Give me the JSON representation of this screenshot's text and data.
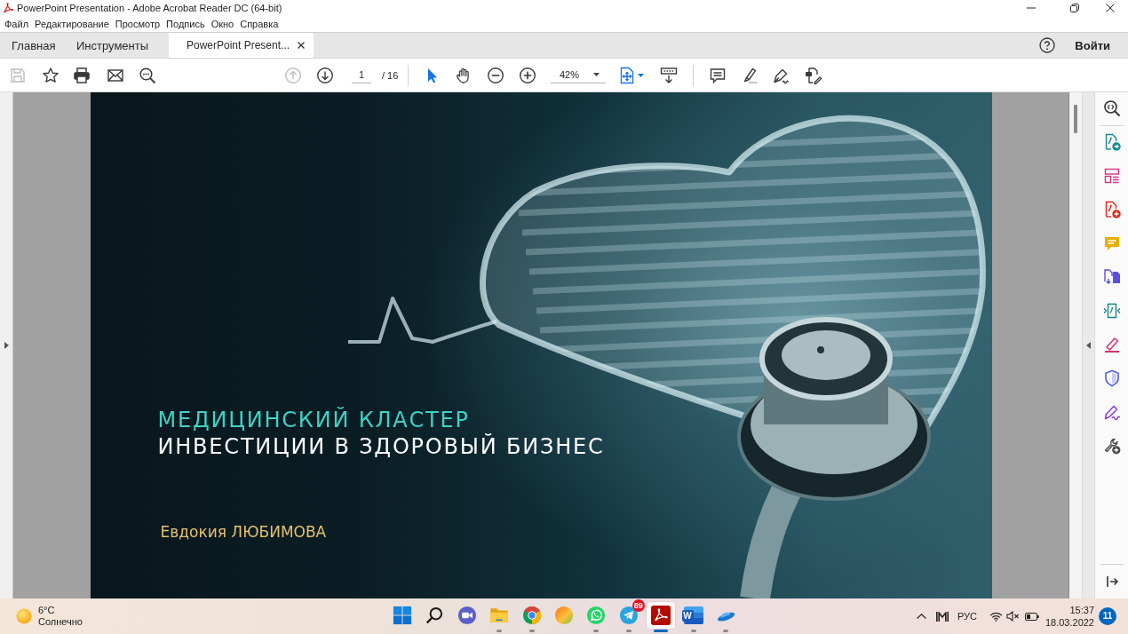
{
  "window": {
    "title": "PowerPoint Presentation - Adobe Acrobat Reader DC (64-bit)"
  },
  "menu": [
    "Файл",
    "Редактирование",
    "Просмотр",
    "Подпись",
    "Окно",
    "Справка"
  ],
  "tabs": [
    {
      "label": "Главная",
      "kind": "nav",
      "selected": false
    },
    {
      "label": "Инструменты",
      "kind": "nav",
      "selected": false
    },
    {
      "label": "PowerPoint Present...",
      "kind": "document",
      "selected": true
    }
  ],
  "sign_in": "Войти",
  "toolbar": {
    "save": {
      "disabled": true
    },
    "previous_page": {
      "disabled": true
    },
    "next_page": {
      "disabled": false
    },
    "page_number": "1",
    "page_count": "/ 16",
    "pointer_tools": [
      {
        "kind": "select",
        "selected": true
      },
      {
        "kind": "hand",
        "selected": false
      }
    ],
    "zoom": "42%"
  },
  "document": {
    "slide": {
      "title": "МЕДИЦИНСКИЙ КЛАСТЕР",
      "subtitle": "ИНВЕСТИЦИИ В ЗДОРОВЫЙ БИЗНЕС",
      "author": "Евдокия ЛЮБИМОВА"
    }
  },
  "taskbar": {
    "weather": {
      "temperature": "6°C",
      "condition": "Солнечно"
    },
    "apps": [
      {
        "kind": "start",
        "running": false,
        "selected": false
      },
      {
        "kind": "search",
        "running": false,
        "selected": false
      },
      {
        "kind": "chat",
        "running": false,
        "selected": false
      },
      {
        "kind": "folder",
        "running": true,
        "selected": false
      },
      {
        "kind": "chrome",
        "running": true,
        "selected": false
      },
      {
        "kind": "orb",
        "running": false,
        "selected": false
      },
      {
        "kind": "whatsapp",
        "running": true,
        "selected": false
      },
      {
        "kind": "telegram",
        "running": true,
        "selected": false,
        "badge": "89"
      },
      {
        "kind": "acrobat",
        "running": true,
        "selected": true
      },
      {
        "kind": "word",
        "running": true,
        "selected": false,
        "glyph": "W"
      },
      {
        "kind": "saucer",
        "running": true,
        "selected": false
      }
    ],
    "tray": {
      "language": "РУС",
      "volume_muted": true,
      "time": "15:37",
      "date": "18.03.2022",
      "notifications": "11"
    }
  }
}
